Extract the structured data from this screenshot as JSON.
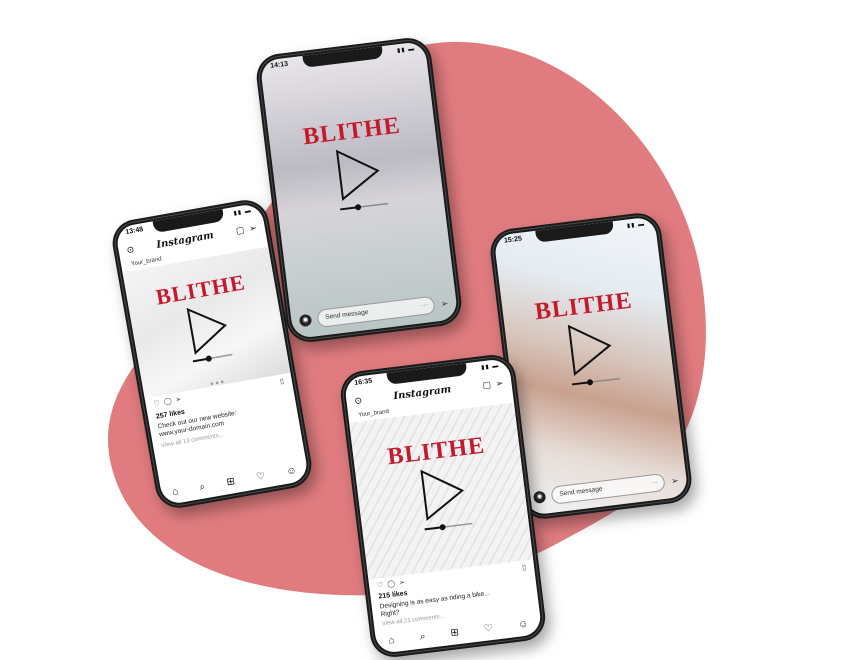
{
  "colors": {
    "blob": "#e07c7f",
    "brand_red": "#c5192d",
    "phone_frame": "#1a1a1a"
  },
  "brand_text": "BLITHE",
  "phones": {
    "feed1": {
      "time": "13:48",
      "app_title": "Instagram",
      "username": "Your_brand",
      "likes": "257 likes",
      "caption_1": "Check out our new website:",
      "caption_2": "www.your-domain.com",
      "comments": "View all 13 comments..."
    },
    "story1": {
      "time": "14:13",
      "message_placeholder": "Send message",
      "more": "···"
    },
    "story2": {
      "time": "15:25",
      "message_placeholder": "Send message",
      "more": "···"
    },
    "feed2": {
      "time": "16:35",
      "app_title": "Instagram",
      "username": "Your_brand",
      "likes": "215 likes",
      "caption_1": "Designing is as easy as riding a bike...",
      "caption_2": "Right?",
      "comments": "View all 21 comments..."
    }
  },
  "icons": {
    "camera": "camera-icon",
    "heart": "heart-icon",
    "comment": "comment-icon",
    "share": "share-icon",
    "bookmark": "bookmark-icon",
    "home": "home-icon",
    "search": "search-icon",
    "add": "add-post-icon",
    "profile": "profile-icon",
    "send": "send-icon"
  }
}
